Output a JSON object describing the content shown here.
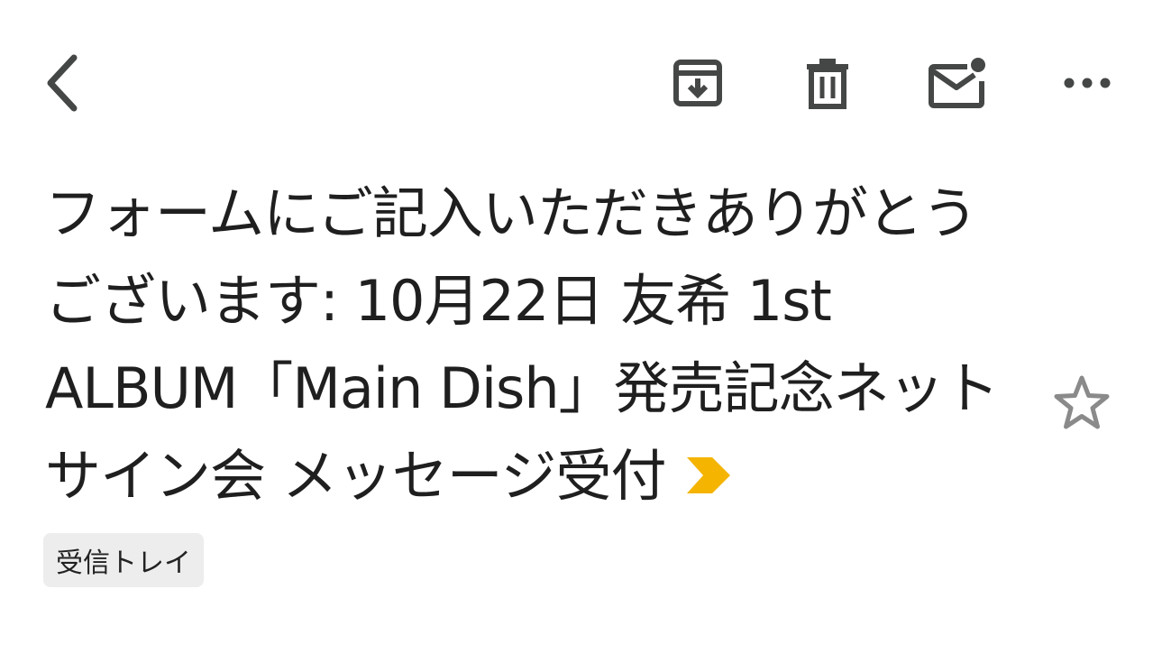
{
  "toolbar": {
    "icons": [
      "back-arrow-icon",
      "archive-icon",
      "delete-icon",
      "mark-unread-icon",
      "more-icon"
    ]
  },
  "message": {
    "subject": "フォームにご記入いただきありがとうございます: 10月22日 友希 1st ALBUM「Main Dish」発売記念ネットサイン会 メッセージ受付",
    "important_marker_color": "#F4B400",
    "starred": false,
    "label": "受信トレイ"
  },
  "colors": {
    "icon": "#444746",
    "text": "#1f1f1f",
    "chip_bg": "#ededed",
    "star_outline": "#8a8a8a"
  }
}
